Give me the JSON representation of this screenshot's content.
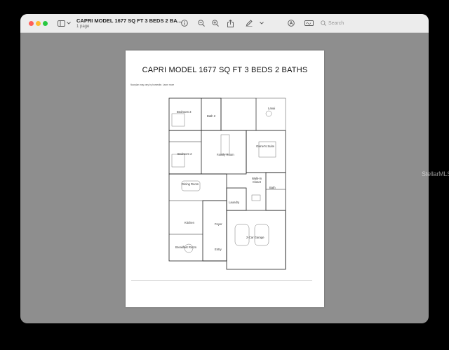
{
  "window": {
    "doc_title": "CAPRI MODEL 1677 SQ FT 3 BEDS 2 BA...",
    "page_count": "1 page",
    "search_placeholder": "Search"
  },
  "toolbar_icons": [
    "sidebar-icon",
    "chevron-down-icon",
    "info-icon",
    "zoom-out-icon",
    "zoom-in-icon",
    "share-icon",
    "pen-icon",
    "chevron-down-icon",
    "markup-icon",
    "signature-icon",
    "search-icon"
  ],
  "page": {
    "title": "CAPRI MODEL 1677 SQ FT  3 BEDS  2 BATHS",
    "note": "floorplan may vary by homesite. Learn more",
    "rooms": {
      "bedroom3": "Bedroom 3",
      "bath2": "Bath 2",
      "lanai": "Lanai",
      "owners_suite": "Owner's Suite",
      "bedroom2": "Bedroom 2",
      "family_room": "Family Room",
      "walk_in_closet_1": "Walk-In",
      "walk_in_closet_2": "Closet",
      "bath": "Bath",
      "dining_room": "Dining Room",
      "laundry": "Laundry",
      "kitchen": "Kitchen",
      "foyer": "Foyer",
      "garage": "2-Car Garage",
      "breakfast_room": "Breakfast Room",
      "entry": "Entry"
    }
  },
  "watermark": "StellarMLS",
  "colors": {
    "titlebar": "#ececec",
    "viewer_bg": "#8e8e8e",
    "close": "#fe5f57",
    "minimize": "#febc2e",
    "maximize": "#28c840"
  }
}
